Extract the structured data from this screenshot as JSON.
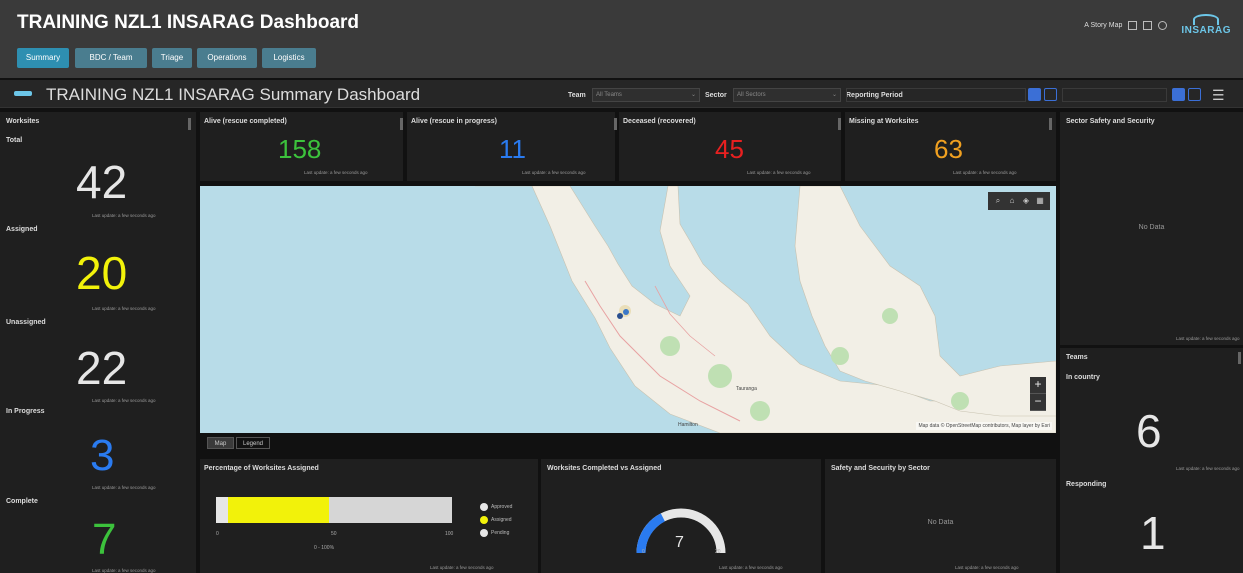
{
  "header": {
    "title": "TRAINING NZL1 INSARAG Dashboard",
    "tabs": [
      {
        "label": "Summary",
        "active": true
      },
      {
        "label": "BDC / Team",
        "active": false
      },
      {
        "label": "Triage",
        "active": false
      },
      {
        "label": "Operations",
        "active": false
      },
      {
        "label": "Logistics",
        "active": false
      }
    ],
    "story_map": "A Story Map",
    "logo_text": "INSARAG"
  },
  "subheader": {
    "title": "TRAINING NZL1 INSARAG Summary Dashboard",
    "team_label": "Team",
    "team_value": "All Teams",
    "sector_label": "Sector",
    "sector_value": "All Sectors",
    "period_label": "Reporting Period"
  },
  "worksites": {
    "title": "Worksites",
    "last_update": "Last update: a few seconds ago",
    "groups": [
      {
        "label": "Total",
        "value": "42",
        "color": "#e6e6e6"
      },
      {
        "label": "Assigned",
        "value": "20",
        "color": "#f2f20a"
      },
      {
        "label": "Unassigned",
        "value": "22",
        "color": "#e6e6e6"
      },
      {
        "label": "In Progress",
        "value": "3",
        "color": "#2a7bf0"
      },
      {
        "label": "Complete",
        "value": "7",
        "color": "#3cc23c"
      }
    ]
  },
  "status": {
    "last_update": "Last update: a few seconds ago",
    "cards": [
      {
        "label": "Alive (rescue completed)",
        "value": "158",
        "color": "#3cc23c"
      },
      {
        "label": "Alive (rescue in progress)",
        "value": "11",
        "color": "#2a7bf0"
      },
      {
        "label": "Deceased (recovered)",
        "value": "45",
        "color": "#e82020"
      },
      {
        "label": "Missing at Worksites",
        "value": "63",
        "color": "#f0a020"
      }
    ]
  },
  "map": {
    "tabs": [
      "Map",
      "Legend"
    ],
    "attribution": "Map data © OpenStreetMap contributors, Map layer by Esri",
    "zoom_in": "+",
    "zoom_out": "−",
    "place_labels": [
      "Tauranga",
      "Hamilton"
    ]
  },
  "sector_safety": {
    "title": "Sector Safety and Security",
    "no_data": "No Data",
    "last_update": "Last update: a few seconds ago"
  },
  "teams": {
    "title": "Teams",
    "last_update": "Last update: a few seconds ago",
    "groups": [
      {
        "label": "In country",
        "value": "6"
      },
      {
        "label": "Responding",
        "value": "1"
      }
    ]
  },
  "pct_assigned": {
    "title": "Percentage of Worksites Assigned",
    "ticks": [
      "0",
      "50",
      "100"
    ],
    "range": "0 - 100%",
    "last_update": "Last update: a few seconds ago",
    "legend": [
      {
        "label": "Approved",
        "color": "#e6e6e6"
      },
      {
        "label": "Assigned",
        "color": "#f2f20a"
      },
      {
        "label": "Pending",
        "color": "#e6e6e6"
      }
    ],
    "segments": [
      {
        "color": "#e6e6e6",
        "fraction": 0.05
      },
      {
        "color": "#f2f20a",
        "fraction": 0.43
      },
      {
        "color": "#d6d6d6",
        "fraction": 0.52
      }
    ]
  },
  "completed_gauge": {
    "title": "Worksites Completed vs Assigned",
    "value": "7",
    "value_num": 7,
    "min": "0",
    "max": "20",
    "max_num": 20,
    "last_update": "Last update: a few seconds ago"
  },
  "safety_by_sector": {
    "title": "Safety and Security by Sector",
    "no_data": "No Data",
    "last_update": "Last update: a few seconds ago"
  },
  "colors": {
    "accent": "#2e8fb1",
    "filter_btn": "#3b6fd6"
  }
}
